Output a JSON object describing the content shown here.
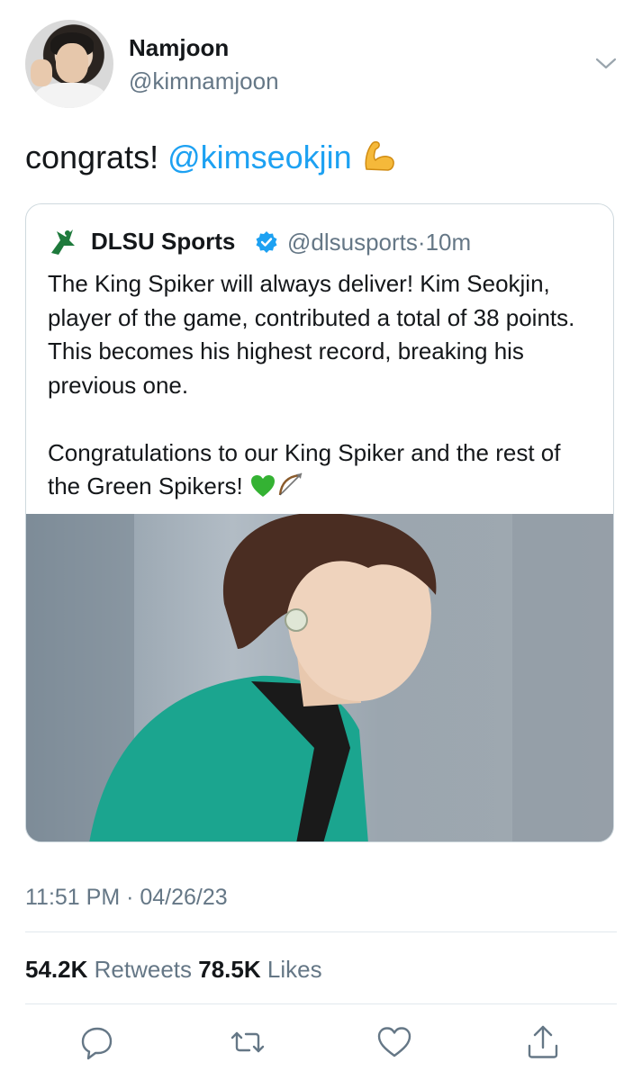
{
  "author": {
    "name": "Namjoon",
    "handle": "@kimnamjoon"
  },
  "tweet": {
    "text": "congrats! ",
    "mention": "@kimseokjin",
    "emoji": "flexed-biceps"
  },
  "quote": {
    "name": "DLSU Sports",
    "handle": "@dlsusports",
    "separator": "·",
    "time": "10m",
    "paragraph1": "The King Spiker will always deliver! Kim Seokjin, player of the game, contributed a total of 38 points. This becomes his highest record, breaking his previous one.",
    "paragraph2": "Congratulations to our King Spiker and the rest of the Green Spikers! ",
    "paragraph2_emojis": [
      "green-heart",
      "bow-and-arrow"
    ]
  },
  "meta": {
    "timestamp": "11:51 PM · 04/26/23"
  },
  "stats": {
    "retweets_count": "54.2K",
    "retweets_label": "Retweets",
    "likes_count": "78.5K",
    "likes_label": "Likes"
  },
  "actions": [
    "reply-icon",
    "retweet-icon",
    "like-icon",
    "share-icon"
  ],
  "colors": {
    "link": "#1da1f2",
    "secondary_text": "#657786",
    "verified": "#1da1f2",
    "primary_text": "#14171a",
    "divider": "#e1e8ed"
  }
}
